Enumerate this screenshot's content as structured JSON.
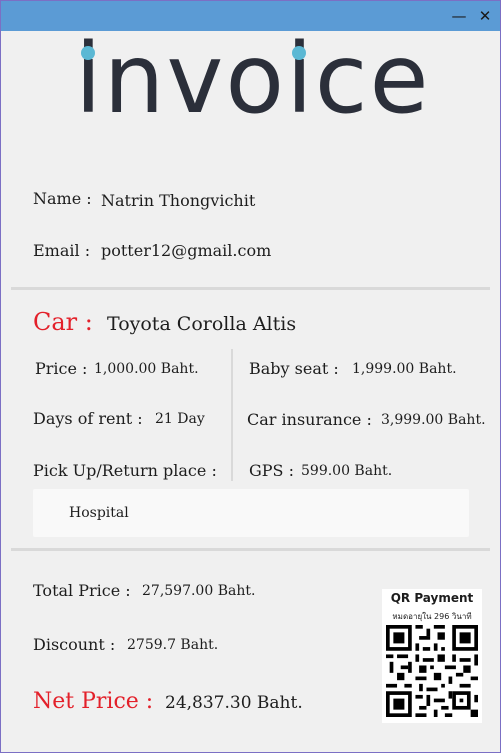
{
  "window": {
    "minimize_glyph": "—",
    "close_glyph": "✕"
  },
  "logo": {
    "text": "invoice",
    "accent_color": "#5bb8d4"
  },
  "customer": {
    "name_label": "Name :",
    "name_value": "Natrin Thongvichit",
    "email_label": "Email :",
    "email_value": "potter12@gmail.com"
  },
  "car": {
    "label": "Car :",
    "value": "Toyota Corolla Altis"
  },
  "details_left": {
    "price_label": "Price :",
    "price_value": "1,000.00 Baht.",
    "days_label": "Days of rent :",
    "days_value": "21 Day",
    "pickup_label": "Pick Up/Return place :",
    "pickup_value": "Hospital"
  },
  "details_right": {
    "baby_seat_label": "Baby seat :",
    "baby_seat_value": "1,999.00 Baht.",
    "insurance_label": "Car insurance :",
    "insurance_value": "3,999.00 Baht.",
    "gps_label": "GPS :",
    "gps_value": "599.00 Baht."
  },
  "totals": {
    "total_label": "Total Price :",
    "total_value": "27,597.00 Baht.",
    "discount_label": "Discount :",
    "discount_value": "2759.7 Baht.",
    "net_label": "Net Price :",
    "net_value": "24,837.30 Baht."
  },
  "qr": {
    "title": "QR Payment",
    "subtitle": "หมดอายุใน 296 วินาที",
    "icon": "qr-code-icon"
  },
  "colors": {
    "titlebar": "#5b9bd5",
    "accent_red": "#e3202a"
  }
}
